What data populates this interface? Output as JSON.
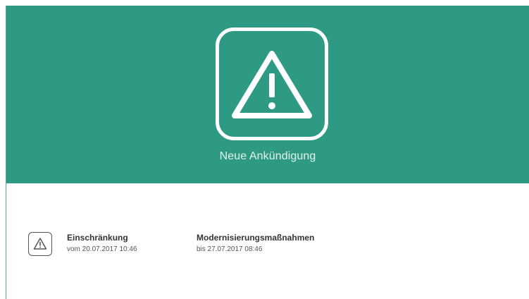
{
  "header": {
    "title": "Neue Ankündigung",
    "icon": "warning-icon",
    "background_color": "#2f9a83"
  },
  "notice": {
    "icon": "warning-icon",
    "type_label": "Einschränkung",
    "start_text": "vom 20.07.2017 10:46",
    "reason_label": "Modernisierungsmaßnahmen",
    "end_text": "bis 27.07.2017 08:46"
  }
}
